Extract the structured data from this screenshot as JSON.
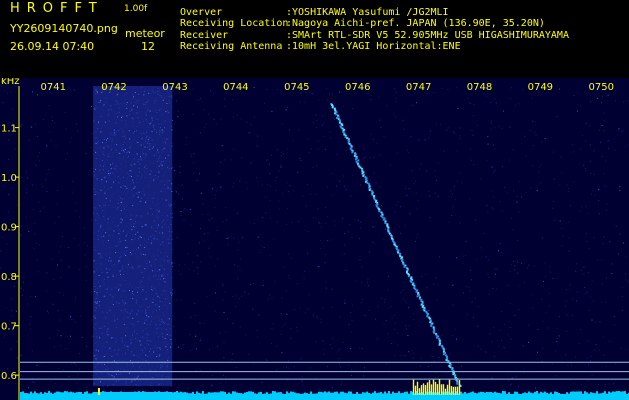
{
  "header": {
    "app_title": "HROFFT",
    "app_version": "1.00f",
    "file_name": "YY2609140740.png",
    "file_datetime": "26.09.14 07:40",
    "event_type": "meteor",
    "event_count": "12",
    "info": [
      {
        "label": "Overver",
        "value": ":YOSHIKAWA Yasufumi /JG2MLI"
      },
      {
        "label": "Receiving Location",
        "value": ":Nagoya Aichi-pref. JAPAN (136.90E, 35.20N)"
      },
      {
        "label": "Receiver",
        "value": ":SMArt RTL-SDR V5 52.905MHz USB HIGASHIMURAYAMA"
      },
      {
        "label": "Receiving Antenna",
        "value": ":10mH 3el.YAGI Horizontal:ENE"
      }
    ]
  },
  "spectrogram": {
    "y_unit_label": "kHz",
    "y_ticks": [
      "1.1",
      "1.0",
      "0.9",
      "0.8",
      "0.7",
      "0.6"
    ],
    "y_range_khz": [
      0.57,
      1.18
    ],
    "time_labels": [
      "0741",
      "0742",
      "0743",
      "0744",
      "0745",
      "0746",
      "0747",
      "0748",
      "0749",
      "0750"
    ],
    "time_range_min": [
      0,
      10
    ],
    "marker_lines_khz": [
      0.626,
      0.607,
      0.592
    ],
    "noise_band_minutes": [
      1.2,
      2.5
    ],
    "meteor_trace": {
      "start": {
        "t_min": 5.1,
        "khz": 1.15
      },
      "end": {
        "t_min": 7.2,
        "khz": 0.58
      }
    },
    "colors": {
      "background": "#000033",
      "text": "#ffff00",
      "signal": "#55ddff",
      "marker_line": "#9fbfe6",
      "baseline": "#00ccff"
    }
  }
}
